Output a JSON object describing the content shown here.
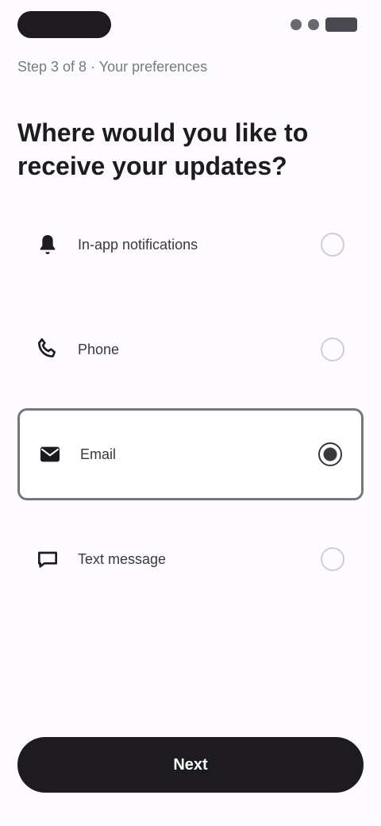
{
  "status_bar": {
    "time": "",
    "icons": [
      "signal-icon",
      "wifi-icon",
      "battery-icon"
    ]
  },
  "header": {
    "step": "Step 3 of 8 · Your preferences",
    "question": "Where would you like to receive your updates?"
  },
  "options": [
    {
      "label": "In-app notifications",
      "icon": "bell-icon",
      "selected": false
    },
    {
      "label": "Phone",
      "icon": "phone-icon",
      "selected": false
    },
    {
      "label": "Email",
      "icon": "mail-icon",
      "selected": true
    },
    {
      "label": "Text message",
      "icon": "message-icon",
      "selected": false
    }
  ],
  "footer": {
    "primary_label": "Next"
  },
  "colors": {
    "background": "#fdfbfd",
    "text": "#1d1b20",
    "muted": "#7a7880",
    "button": "#1d1b20"
  }
}
